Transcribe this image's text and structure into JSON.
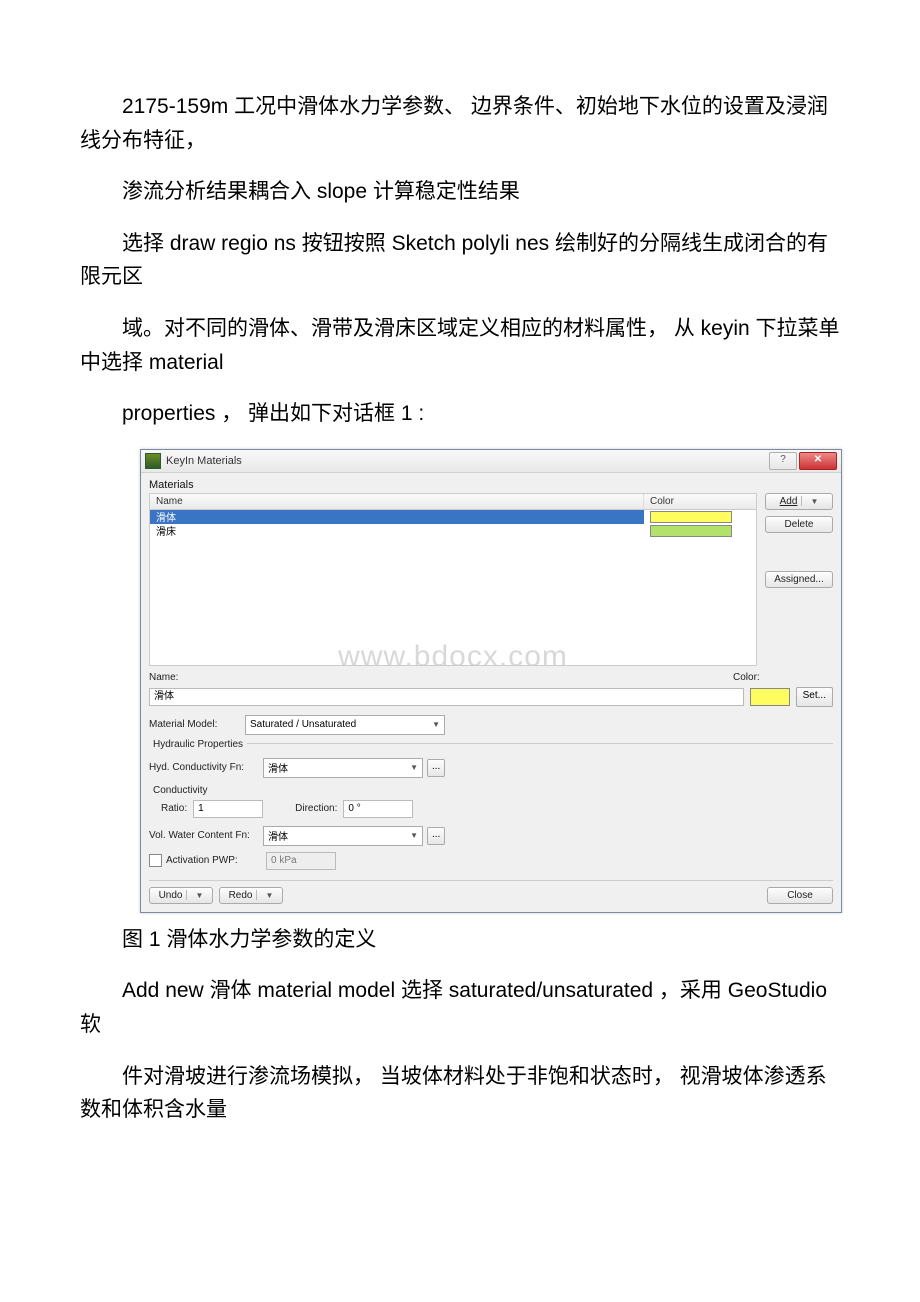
{
  "doc": {
    "p1": "2175-159m 工况中滑体水力学参数、 边界条件、初始地下水位的设置及浸润线分布特征，",
    "p2": "渗流分析结果耦合入 slope 计算稳定性结果",
    "p3": "选择 draw regio ns 按钮按照 Sketch polyli nes 绘制好的分隔线生成闭合的有限元区",
    "p4": "域。对不同的滑体、滑带及滑床区域定义相应的材料属性，  从 keyin 下拉菜单中选择 material",
    "p5": "properties ， 弹出如下对话框 1 :",
    "caption": "图 1 滑体水力学参数的定义",
    "p6": "Add new 滑体 material model 选择 saturated/unsaturated ，采用 GeoStudio 软",
    "p7": "件对滑坡进行渗流场模拟，  当坡体材料处于非饱和状态时，  视滑坡体渗透系数和体积含水量"
  },
  "dialog": {
    "title": "KeyIn Materials",
    "section": "Materials",
    "columns": {
      "name": "Name",
      "color": "Color"
    },
    "rows": [
      {
        "name": "滑体",
        "colorClass": "yellow",
        "selected": true
      },
      {
        "name": "滑床",
        "colorClass": "green",
        "selected": false
      }
    ],
    "sideButtons": {
      "add": "Add",
      "delete": "Delete",
      "assigned": "Assigned..."
    },
    "nameLabel": "Name:",
    "nameValue": "滑体",
    "colorLabel": "Color:",
    "setLabel": "Set...",
    "materialModelLabel": "Material Model:",
    "materialModelValue": "Saturated / Unsaturated",
    "hydraulicGroup": "Hydraulic Properties",
    "hydCondLabel": "Hyd. Conductivity Fn:",
    "hydCondValue": "滑体",
    "conductivityGroup": "Conductivity",
    "ratioLabel": "Ratio:",
    "ratioValue": "1",
    "directionLabel": "Direction:",
    "directionValue": "0 °",
    "volWaterLabel": "Vol. Water Content Fn:",
    "volWaterValue": "滑体",
    "activationLabel": "Activation PWP:",
    "activationValue": "0 kPa",
    "undo": "Undo",
    "redo": "Redo",
    "close": "Close",
    "ellipsis": "...",
    "helpGlyph": "?",
    "closeGlyph": "✕"
  },
  "watermark": "www.bdocx.com"
}
